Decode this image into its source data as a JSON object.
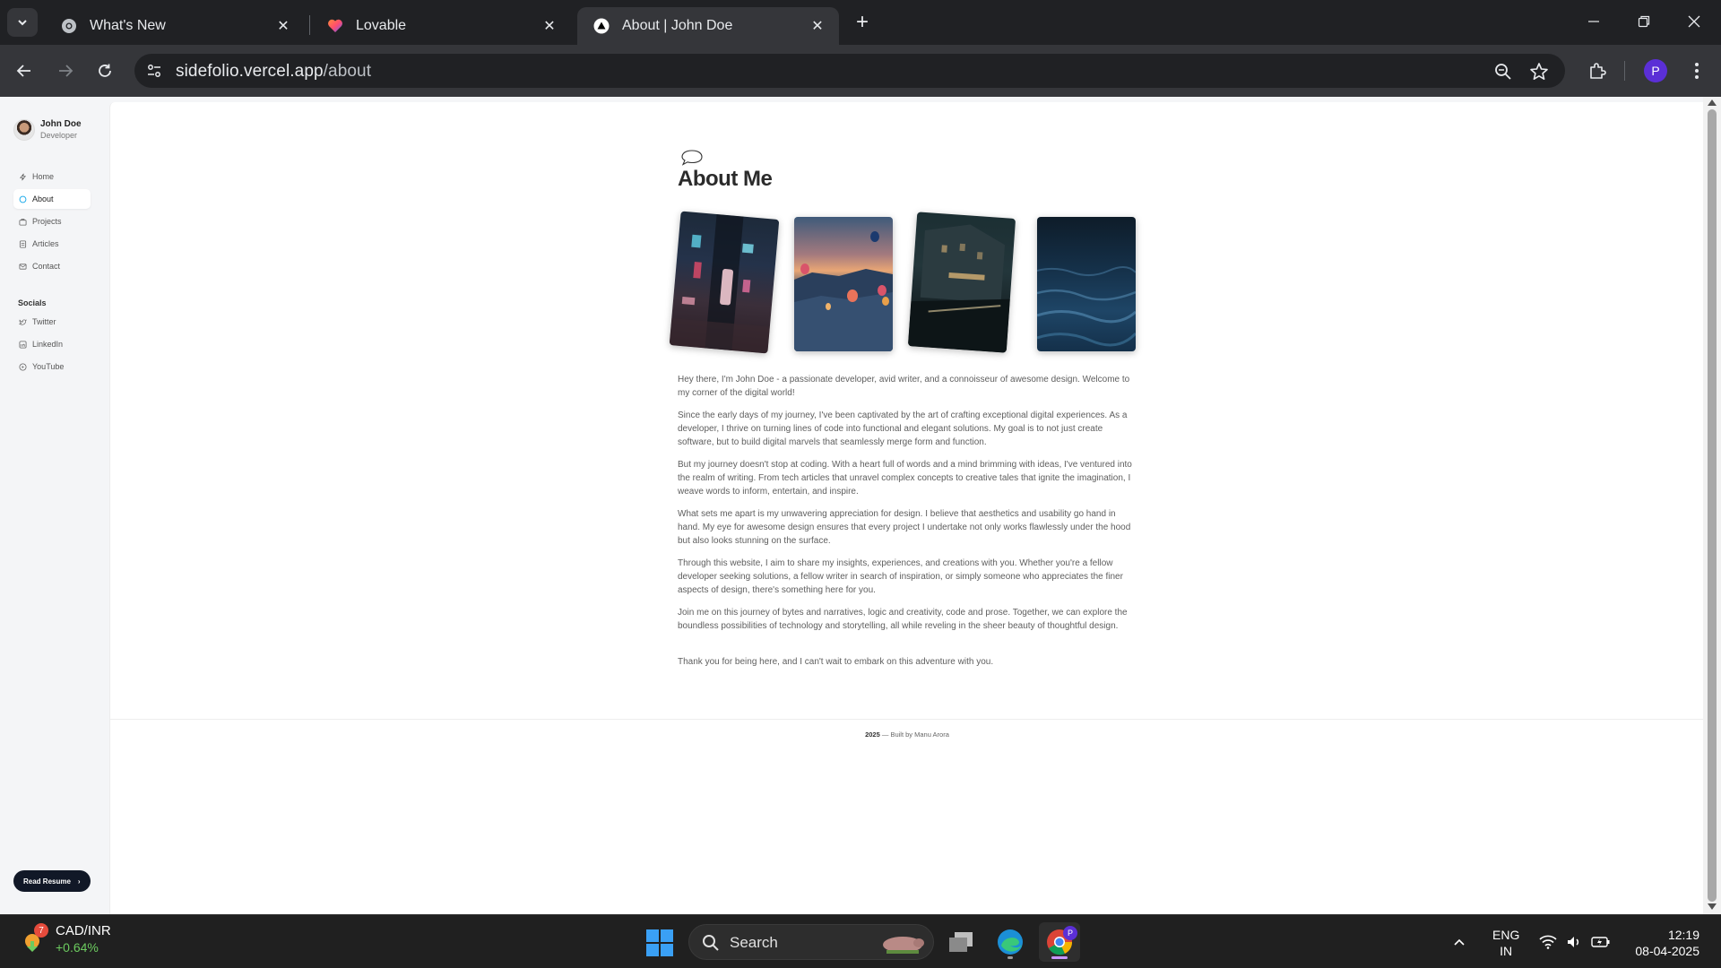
{
  "browser": {
    "tabs": [
      {
        "title": "What's New",
        "active": false
      },
      {
        "title": "Lovable",
        "active": false
      },
      {
        "title": "About | John Doe",
        "active": true
      }
    ],
    "url_domain": "sidefolio.vercel.app",
    "url_path": "/about",
    "profile_initial": "P"
  },
  "sidebar": {
    "name": "John Doe",
    "role": "Developer",
    "nav": [
      {
        "label": "Home",
        "icon": "bolt-icon"
      },
      {
        "label": "About",
        "icon": "chat-icon",
        "active": true
      },
      {
        "label": "Projects",
        "icon": "briefcase-icon"
      },
      {
        "label": "Articles",
        "icon": "document-icon"
      },
      {
        "label": "Contact",
        "icon": "mail-icon"
      }
    ],
    "socials_heading": "Socials",
    "socials": [
      {
        "label": "Twitter",
        "icon": "twitter-icon"
      },
      {
        "label": "LinkedIn",
        "icon": "linkedin-icon"
      },
      {
        "label": "YouTube",
        "icon": "youtube-icon"
      }
    ],
    "resume_button": "Read Resume"
  },
  "main": {
    "title": "About Me",
    "photos": [
      {
        "name": "city-night-alley-photo"
      },
      {
        "name": "hot-air-balloons-photo"
      },
      {
        "name": "night-street-building-photo"
      },
      {
        "name": "ocean-waves-photo"
      }
    ],
    "paragraphs": [
      "Hey there, I'm John Doe - a passionate developer, avid writer, and a connoisseur of awesome design. Welcome to my corner of the digital world!",
      "Since the early days of my journey, I've been captivated by the art of crafting exceptional digital experiences. As a developer, I thrive on turning lines of code into functional and elegant solutions. My goal is to not just create software, but to build digital marvels that seamlessly merge form and function.",
      "But my journey doesn't stop at coding. With a heart full of words and a mind brimming with ideas, I've ventured into the realm of writing. From tech articles that unravel complex concepts to creative tales that ignite the imagination, I weave words to inform, entertain, and inspire.",
      "What sets me apart is my unwavering appreciation for design. I believe that aesthetics and usability go hand in hand. My eye for awesome design ensures that every project I undertake not only works flawlessly under the hood but also looks stunning on the surface.",
      "Through this website, I aim to share my insights, experiences, and creations with you. Whether you're a fellow developer seeking solutions, a fellow writer in search of inspiration, or simply someone who appreciates the finer aspects of design, there's something here for you.",
      "Join me on this journey of bytes and narratives, logic and creativity, code and prose. Together, we can explore the boundless possibilities of technology and storytelling, all while reveling in the sheer beauty of thoughtful design.",
      "Thank you for being here, and I can't wait to embark on this adventure with you."
    ],
    "footer_year": "2025",
    "footer_text": "— Built by Manu Arora"
  },
  "taskbar": {
    "widget_badge": "7",
    "widget_title": "CAD/INR",
    "widget_value": "+0.64%",
    "search_label": "Search",
    "lang_line1": "ENG",
    "lang_line2": "IN",
    "time": "12:19",
    "date": "08-04-2025"
  }
}
